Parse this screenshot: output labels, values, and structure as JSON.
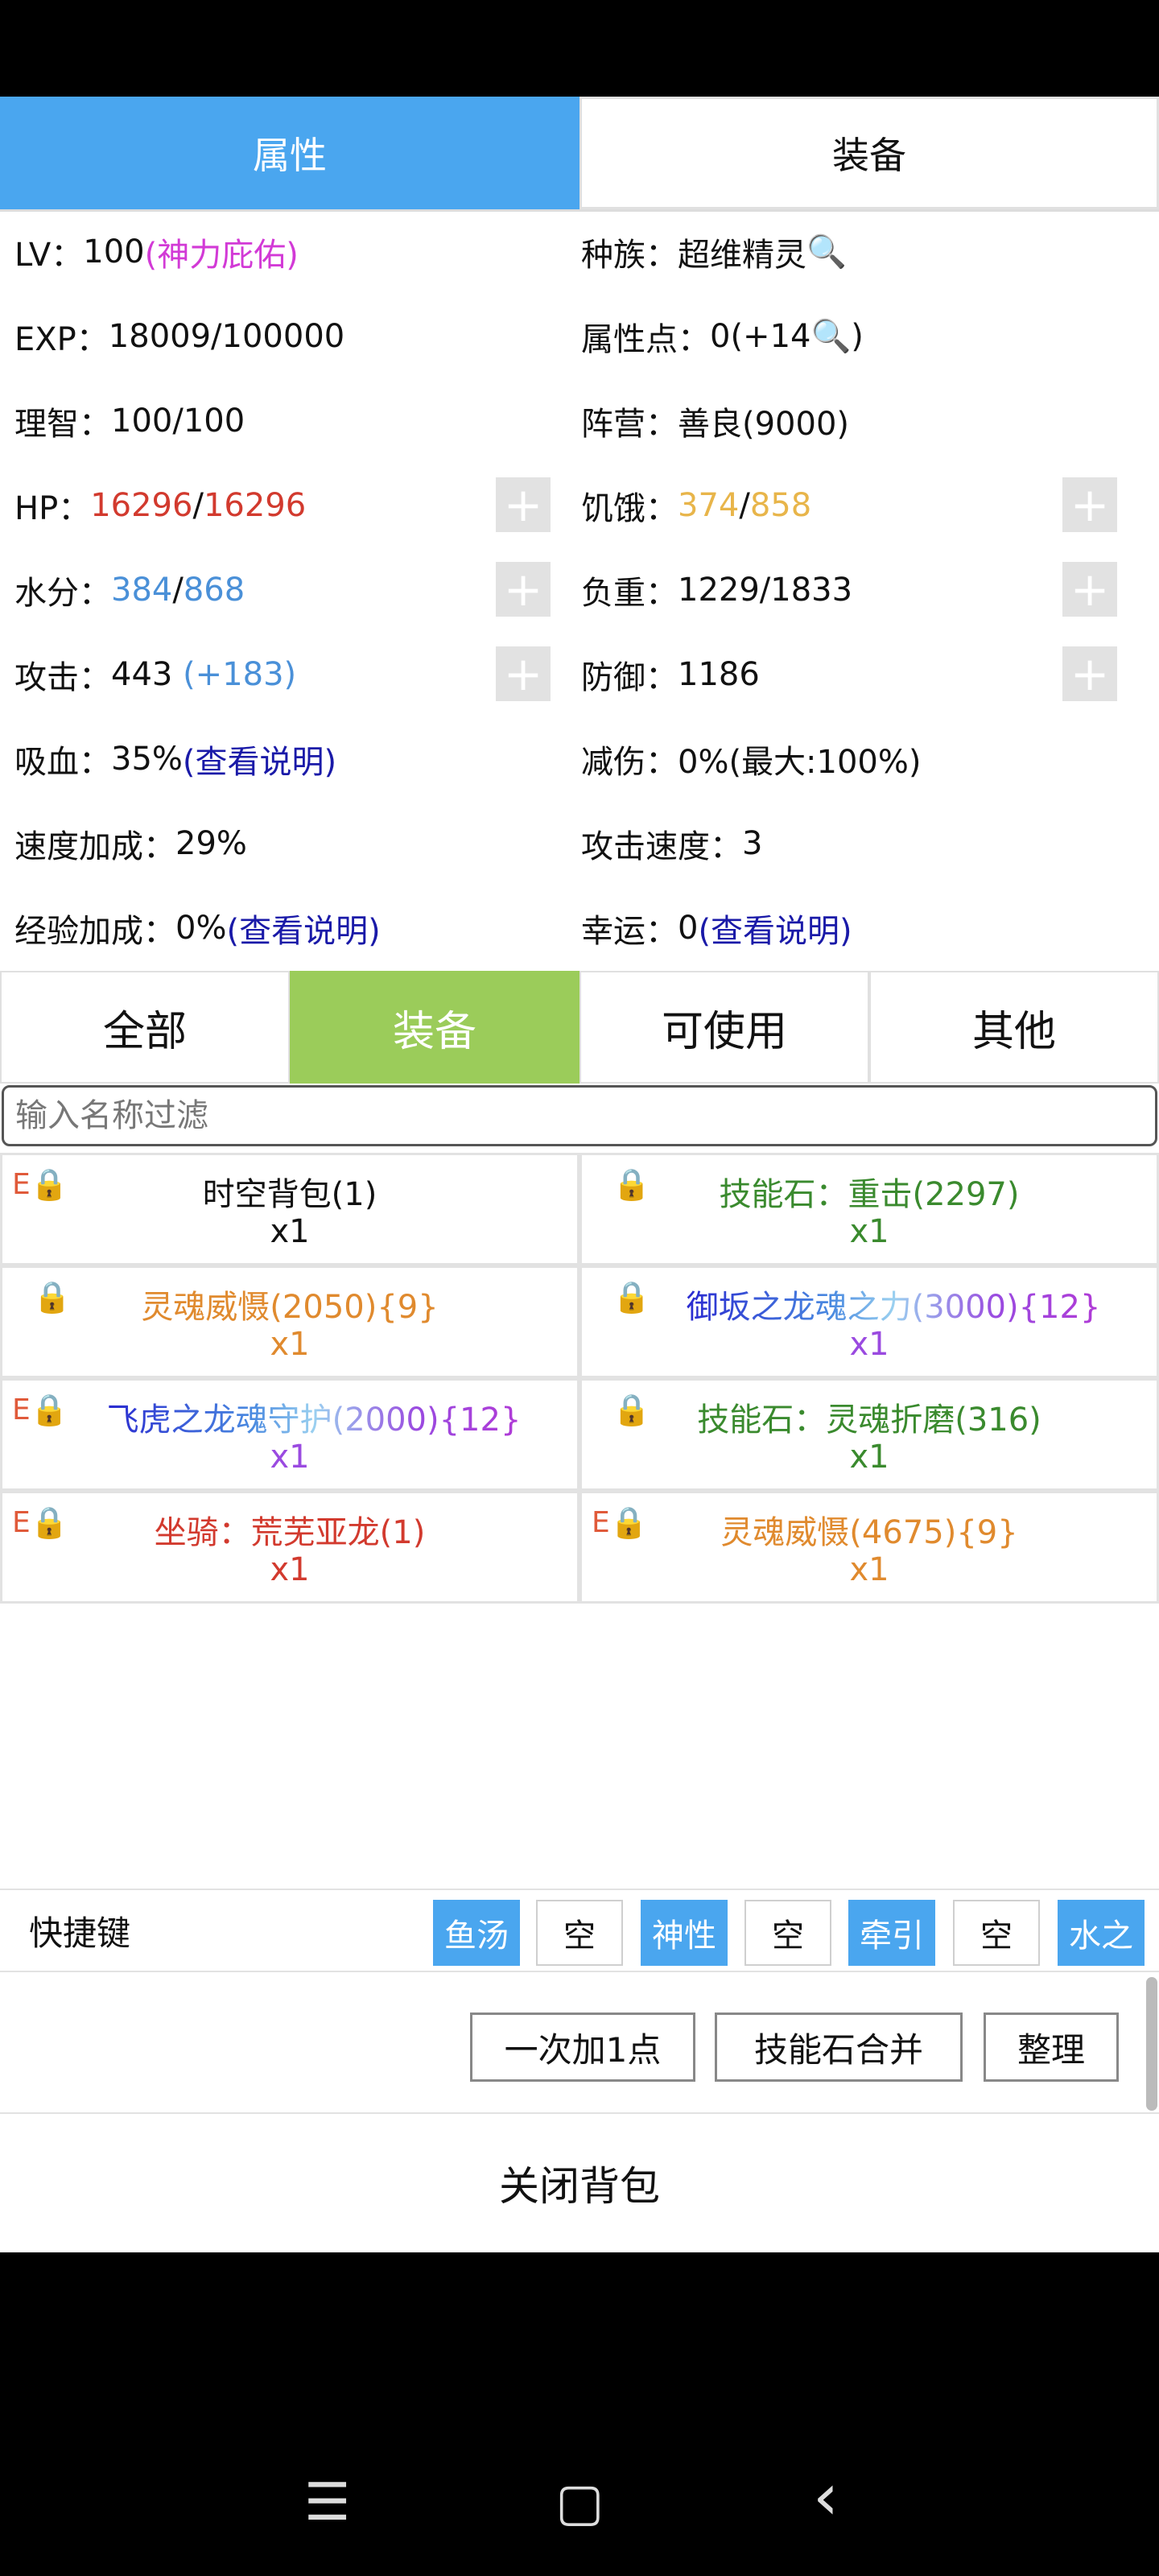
{
  "tabs_top": [
    "属性",
    "装备"
  ],
  "stats": {
    "lv_label": "LV：",
    "lv_value": "100",
    "lv_note": "(神力庇佑)",
    "race_label": "种族：",
    "race_value": "超维精灵",
    "exp_label": "EXP：",
    "exp_value": "18009/100000",
    "points_label": "属性点：",
    "points_value": "0(+14",
    "points_end": ")",
    "sanity_label": "理智：",
    "sanity_value": "100/100",
    "camp_label": "阵营：",
    "camp_value": "善良(9000)",
    "hp_label": "HP：",
    "hp_cur": "16296",
    "hp_max": "16296",
    "hunger_label": "饥饿：",
    "hunger_cur": "374",
    "hunger_max": "858",
    "water_label": "水分：",
    "water_cur": "384",
    "water_max": "868",
    "load_label": "负重：",
    "load_value": "1229/1833",
    "atk_label": "攻击：",
    "atk_value": "443",
    "atk_bonus": "(+183)",
    "def_label": "防御：",
    "def_value": "1186",
    "leech_label": "吸血：",
    "leech_value": "35%",
    "leech_link": "(查看说明)",
    "dmgred_label": "减伤：",
    "dmgred_value": "0%(最大:100%)",
    "speed_label": "速度加成：",
    "speed_value": "29%",
    "atkspd_label": "攻击速度：",
    "atkspd_value": "3",
    "expbonus_label": "经验加成：",
    "expbonus_value": "0%",
    "expbonus_link": "(查看说明)",
    "luck_label": "幸运：",
    "luck_value": "0",
    "luck_link": "(查看说明)",
    "plus_symbol": "+"
  },
  "filter_tabs": [
    "全部",
    "装备",
    "可使用",
    "其他"
  ],
  "filter_placeholder": "输入名称过滤",
  "items": [
    {
      "badge": "E",
      "name": "时空背包(1)",
      "qty": "x1"
    },
    {
      "badge": "",
      "name": "技能石：重击(2297)",
      "qty": "x1"
    },
    {
      "badge": "",
      "name": "灵魂威慑(2050){9}",
      "qty": "x1"
    },
    {
      "badge": "",
      "name": "御坂之龙魂之力(3000){12}",
      "qty": "x1"
    },
    {
      "badge": "E",
      "name": "飞虎之龙魂守护(2000){12}",
      "qty": "x1"
    },
    {
      "badge": "",
      "name": "技能石：灵魂折磨(316)",
      "qty": "x1"
    },
    {
      "badge": "E",
      "name": "坐骑：荒芜亚龙(1)",
      "qty": "x1"
    },
    {
      "badge": "E",
      "name": "灵魂威慑(4675){9}",
      "qty": "x1"
    }
  ],
  "colors": {
    "tab_active": "#4aa6ef",
    "filter_active": "#9bcc5a",
    "quick_on": "#4aa6ef"
  },
  "quickbar": {
    "label": "快捷键",
    "keys": [
      "鱼汤",
      "空",
      "神性",
      "空",
      "牵引",
      "空",
      "水之"
    ]
  },
  "actions": {
    "add_one": "一次加1点",
    "merge": "技能石合并",
    "sort": "整理"
  },
  "close_label": "关闭背包",
  "nav": {
    "menu": "☰",
    "home": "▢",
    "back": "‹"
  }
}
